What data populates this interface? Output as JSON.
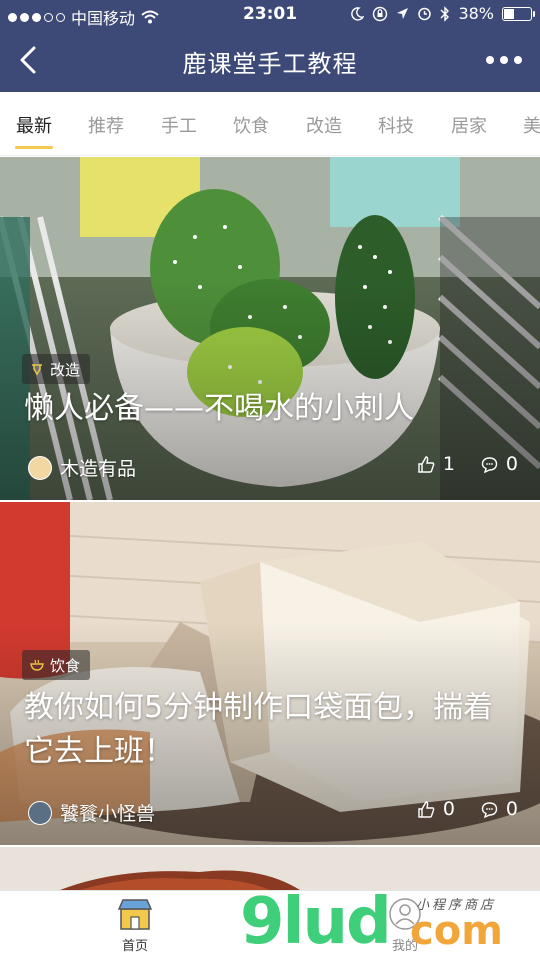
{
  "status_bar": {
    "carrier": "中国移动",
    "time": "23:01",
    "battery_percent": "38%",
    "battery_level": 0.38,
    "signal_bars_filled": 3,
    "icons": [
      "wifi-icon",
      "moon-icon",
      "lock-rotation-icon",
      "location-icon",
      "alarm-icon",
      "bluetooth-icon",
      "battery-icon"
    ]
  },
  "nav": {
    "title": "鹿课堂手工教程",
    "back_icon": "chevron-left-icon",
    "more_icon": "more-dots-icon"
  },
  "tabs": [
    "最新",
    "推荐",
    "手工",
    "饮食",
    "改造",
    "科技",
    "居家",
    "美"
  ],
  "active_tab": "最新",
  "accent_color": "#f2c94c",
  "nav_color": "#3d4a78",
  "cards": [
    {
      "category": "改造",
      "category_icon": "wrench-icon",
      "title": "懒人必备——不喝水的小刺人",
      "author": "木造有品",
      "likes": "1",
      "comments": "0"
    },
    {
      "category": "饮食",
      "category_icon": "bowl-icon",
      "title": "教你如何5分钟制作口袋面包，揣着它去上班！",
      "author": "饕餮小怪兽",
      "likes": "0",
      "comments": "0"
    }
  ],
  "tab_bar": {
    "home_label": "首页",
    "mine_label": "我的"
  },
  "watermark": {
    "main": "9lud",
    "domain": "com",
    "sub": "小程序商店"
  }
}
